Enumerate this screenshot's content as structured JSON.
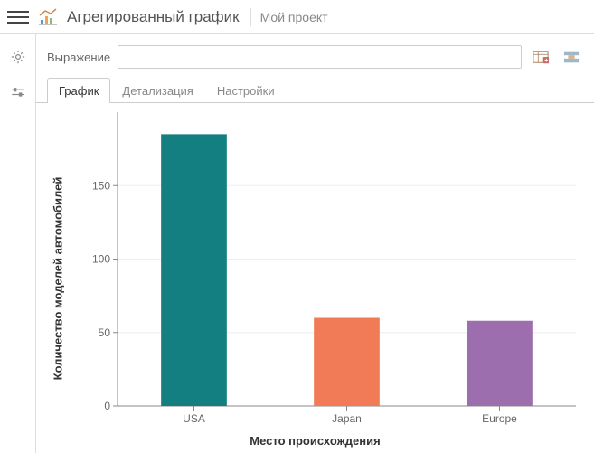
{
  "header": {
    "title": "Агрегированный график",
    "project": "Мой проект"
  },
  "expression": {
    "label": "Выражение",
    "value": ""
  },
  "tabs": [
    {
      "id": "chart",
      "label": "График",
      "active": true
    },
    {
      "id": "detail",
      "label": "Детализация",
      "active": false
    },
    {
      "id": "settings",
      "label": "Настройки",
      "active": false
    }
  ],
  "chart_data": {
    "type": "bar",
    "categories": [
      "USA",
      "Japan",
      "Europe"
    ],
    "values": [
      185,
      60,
      58
    ],
    "title": "",
    "xlabel": "Место происхождения",
    "ylabel": "Количество моделей автомобилей",
    "ylim": [
      0,
      200
    ],
    "yticks": [
      0,
      50,
      100,
      150
    ],
    "colors": [
      "#137f80",
      "#f17b56",
      "#9c6ead"
    ]
  }
}
